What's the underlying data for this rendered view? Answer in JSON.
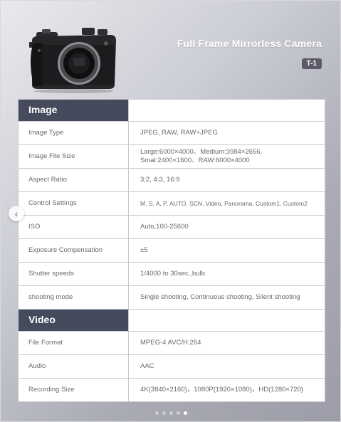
{
  "header": {
    "title": "Full Frame Mirrorless Camera",
    "model": "T-1"
  },
  "camera_image": {
    "icon": "mirrorless-camera-body"
  },
  "sections": [
    {
      "title": "Image",
      "rows": [
        {
          "label": "Image Type",
          "value": "JPEG, RAW, RAW+JPEG"
        },
        {
          "label": "Image File Size",
          "value_lines": [
            "Large:6000×4000、Medium:3984×2656,",
            "Smal:2400×1600、RAW:6000×4000"
          ]
        },
        {
          "label": "Aspect Ratio",
          "value": "3:2, 4:3, 16:9"
        },
        {
          "label": "Control Settings",
          "value": "M, S, A, P, AUTO, SCN, Video, Panorama, Custom1, Custom2"
        },
        {
          "label": "ISO",
          "value": "Auto,100-25600"
        },
        {
          "label": "Exposure Compensation",
          "value": "±5"
        },
        {
          "label": "Shutter speeds",
          "value": "1/4000 to 30sec.,bulb"
        },
        {
          "label": "shooting mode",
          "value": "Single shooting, Continuous shooting, Silent shooting"
        }
      ]
    },
    {
      "title": "Video",
      "rows": [
        {
          "label": "File Format",
          "value": "MPEG-4 AVC/H.264"
        },
        {
          "label": "Audio",
          "value": "AAC"
        },
        {
          "label": "Recording Size",
          "value": "4K(3840×2160)，1080P(1920×1080)，HD(1280×720)"
        }
      ]
    }
  ],
  "carousel": {
    "prev_icon": "chevron-left-icon",
    "total_pages": 5,
    "active_page": 5
  },
  "colors": {
    "section_header_bg": "#454a5c",
    "badge_bg": "#5b5c68",
    "text_gray": "#6a6a72"
  }
}
